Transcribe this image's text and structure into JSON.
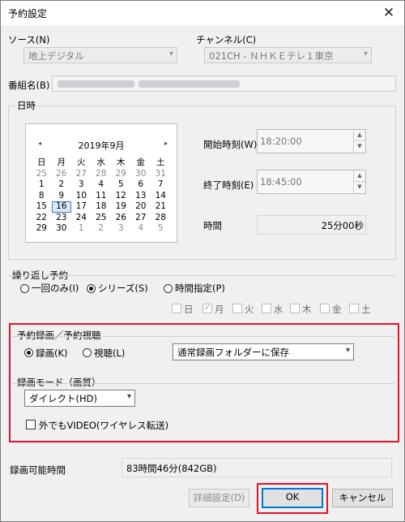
{
  "window": {
    "title": "予約設定",
    "close_glyph": "✕"
  },
  "source": {
    "label": "ソース(N)",
    "value": "地上デジタル"
  },
  "channel": {
    "label": "チャンネル(C)",
    "value": "021CH - ＮＨＫＥテレ１東京"
  },
  "program": {
    "label": "番組名(B)"
  },
  "datetime": {
    "label": "日時",
    "calendar": {
      "month_title": "2019年9月",
      "prev_glyph": "◂",
      "next_glyph": "▸",
      "weekdays": [
        "日",
        "月",
        "火",
        "水",
        "木",
        "金",
        "土"
      ],
      "weeks": [
        [
          "25",
          "26",
          "27",
          "28",
          "29",
          "30",
          "31"
        ],
        [
          "1",
          "2",
          "3",
          "4",
          "5",
          "6",
          "7"
        ],
        [
          "8",
          "9",
          "10",
          "11",
          "12",
          "13",
          "14"
        ],
        [
          "15",
          "16",
          "17",
          "18",
          "19",
          "20",
          "21"
        ],
        [
          "22",
          "23",
          "24",
          "25",
          "26",
          "27",
          "28"
        ],
        [
          "29",
          "30",
          "1",
          "2",
          "3",
          "4",
          "5"
        ]
      ],
      "today": "16"
    },
    "start": {
      "label": "開始時刻(W)",
      "value": "18:20:00"
    },
    "end": {
      "label": "終了時刻(E)",
      "value": "18:45:00"
    },
    "duration": {
      "label": "時間",
      "value": "25分00秒"
    }
  },
  "repeat": {
    "label": "繰り返し予約",
    "options": [
      "一回のみ(I)",
      "シリーズ(S)",
      "時間指定(P)"
    ],
    "selected": "シリーズ(S)",
    "days": [
      "日",
      "月",
      "火",
      "水",
      "木",
      "金",
      "土"
    ],
    "checked_days": [
      "月"
    ]
  },
  "record_mode_group": {
    "label": "予約録画／予約視聴",
    "record_option": "録画(K)",
    "view_option": "視聴(L)",
    "selected": "録画(K)",
    "folder_select": "通常録画フォルダーに保存",
    "quality_label": "録画モード（画質）",
    "quality_select": "ダイレクト(HD)",
    "wireless_checkbox": "外でもVIDEO(ワイヤレス転送)",
    "wireless_checked": false
  },
  "remaining": {
    "label": "録画可能時間",
    "value": "83時間46分(842GB)"
  },
  "buttons": {
    "details": "詳細設定(D)",
    "ok": "OK",
    "cancel": "キャンセル"
  },
  "colors": {
    "highlight": "#e8102a",
    "default_button_border": "#0078d7"
  },
  "icons": {
    "dropdown": "▾",
    "spin_up": "▲",
    "spin_down": "▼",
    "check": "✓"
  }
}
